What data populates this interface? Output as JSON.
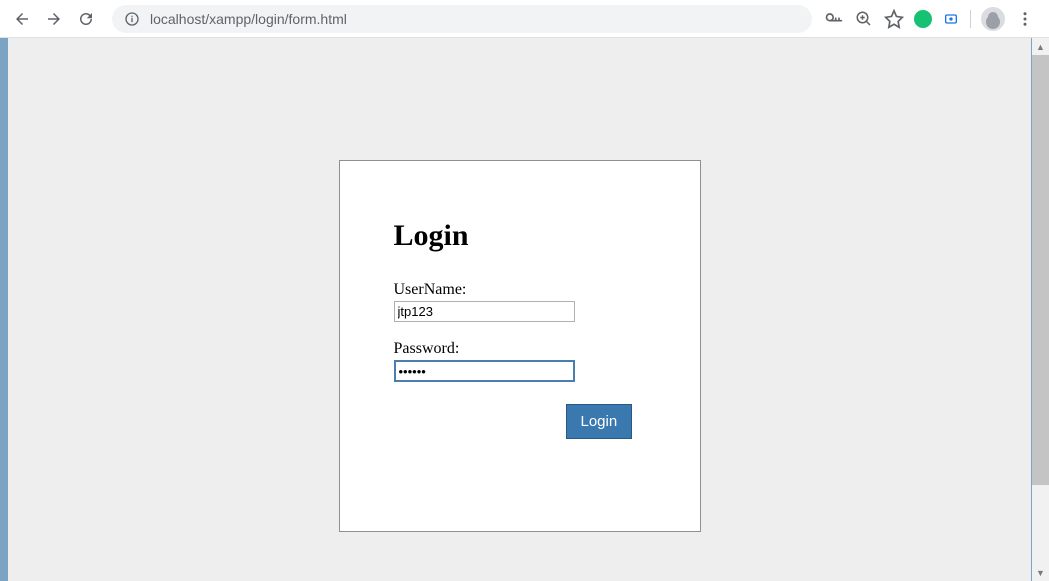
{
  "browser": {
    "url": "localhost/xampp/login/form.html"
  },
  "form": {
    "title": "Login",
    "username_label": "UserName:",
    "username_value": "jtp123",
    "password_label": "Password:",
    "password_value": "••••••",
    "submit_label": "Login"
  }
}
